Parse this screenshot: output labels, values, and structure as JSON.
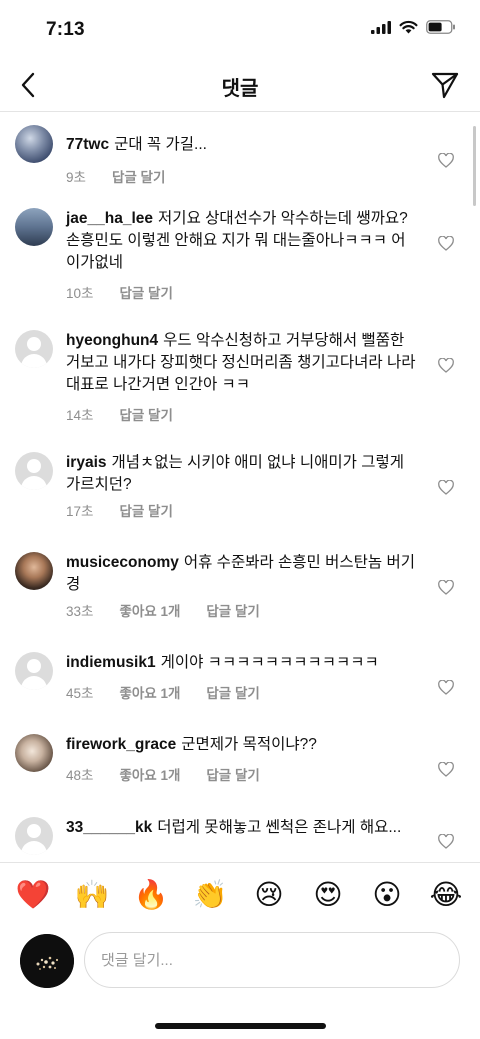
{
  "status": {
    "time": "7:13"
  },
  "header": {
    "title": "댓글"
  },
  "comments": [
    {
      "user": "77twc",
      "text": "군대 꼭 가길...",
      "time": "9초",
      "likes": "",
      "reply": "답글 달기"
    },
    {
      "user": "jae__ha_lee",
      "text": "저기요 상대선수가 악수하는데 쌩까요? 손흥민도 이렇겐 안해요 지가 뭐 대는줄아나ㅋㅋㅋ 어이가없네",
      "time": "10초",
      "likes": "",
      "reply": "답글 달기"
    },
    {
      "user": "hyeonghun4",
      "text": "우드 악수신청하고 거부당해서 뻘쭘한거보고 내가다 장피햇다 정신머리좀 챙기고다녀라 나라대표로 나간거면 인간아 ㅋㅋ",
      "time": "14초",
      "likes": "",
      "reply": "답글 달기"
    },
    {
      "user": "iryais",
      "text": "개념ㅊ없는 시키야 애미 없냐 니애미가 그렇게 가르치던?",
      "time": "17초",
      "likes": "",
      "reply": "답글 달기"
    },
    {
      "user": "musiceconomy",
      "text": "어휴 수준봐라 손흥민 버스탄놈 버기경",
      "time": "33초",
      "likes": "좋아요 1개",
      "reply": "답글 달기"
    },
    {
      "user": "indiemusik1",
      "text": "게이야 ㅋㅋㅋㅋㅋㅋㅋㅋㅋㅋㅋㅋ",
      "time": "45초",
      "likes": "좋아요 1개",
      "reply": "답글 달기"
    },
    {
      "user": "firework_grace",
      "text": "군면제가 목적이냐??",
      "time": "48초",
      "likes": "좋아요 1개",
      "reply": "답글 달기"
    },
    {
      "user": "33______kk",
      "text": "더럽게 못해놓고 쎈척은 존나게 해요...",
      "time": "",
      "likes": "",
      "reply": ""
    }
  ],
  "emojis": [
    "❤️",
    "🙌",
    "🔥",
    "👏",
    "😢",
    "😍",
    "😮",
    "😂"
  ],
  "input": {
    "placeholder": "댓글 달기..."
  }
}
